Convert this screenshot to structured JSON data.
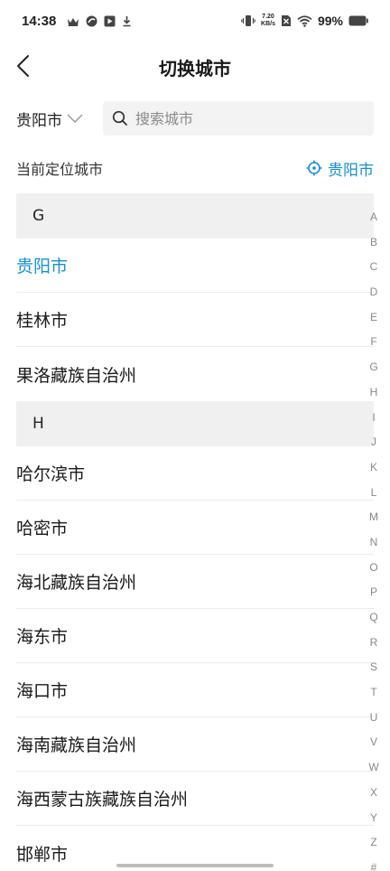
{
  "status_bar": {
    "time": "14:38",
    "net_speed_value": "7.20",
    "net_speed_unit": "KB/s",
    "battery": "99%"
  },
  "header": {
    "title": "切换城市"
  },
  "search": {
    "current_city": "贵阳市",
    "placeholder": "搜索城市"
  },
  "current_location": {
    "label": "当前定位城市",
    "city": "贵阳市"
  },
  "sections": [
    {
      "letter": "G",
      "cities": [
        "贵阳市",
        "桂林市",
        "果洛藏族自治州"
      ]
    },
    {
      "letter": "H",
      "cities": [
        "哈尔滨市",
        "哈密市",
        "海北藏族自治州",
        "海东市",
        "海口市",
        "海南藏族自治州",
        "海西蒙古族藏族自治州",
        "邯郸市"
      ]
    }
  ],
  "alphabet": [
    "A",
    "B",
    "C",
    "D",
    "E",
    "F",
    "G",
    "H",
    "I",
    "J",
    "K",
    "L",
    "M",
    "N",
    "O",
    "P",
    "Q",
    "R",
    "S",
    "T",
    "U",
    "V",
    "W",
    "X",
    "Y",
    "Z",
    "#"
  ],
  "colors": {
    "accent": "#1a8fcc"
  }
}
